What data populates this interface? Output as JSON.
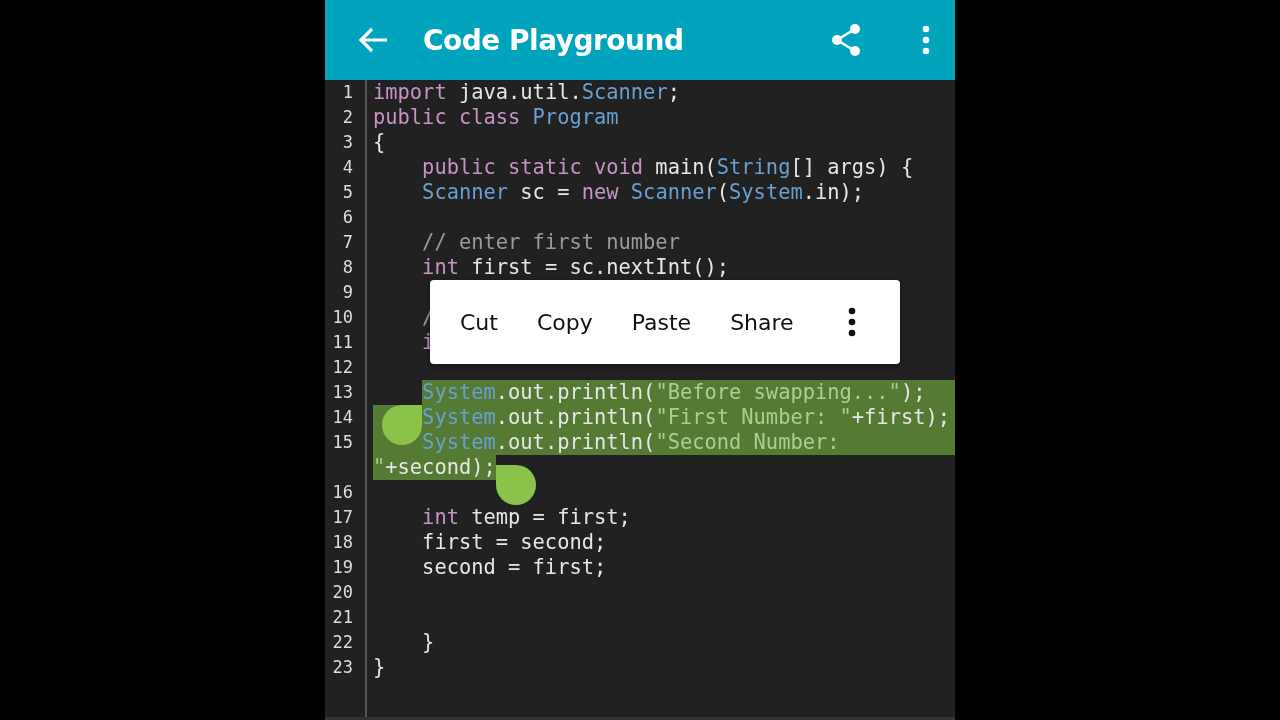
{
  "app_bar": {
    "title": "Code Playground"
  },
  "lines": [
    {
      "number": "1",
      "selected": false,
      "tokens": [
        {
          "text": "import",
          "kind": "kw"
        },
        {
          "text": " java.util.",
          "kind": "plain"
        },
        {
          "text": "Scanner",
          "kind": "type"
        },
        {
          "text": ";",
          "kind": "plain"
        }
      ]
    },
    {
      "number": "2",
      "selected": false,
      "tokens": [
        {
          "text": "public class ",
          "kind": "kw"
        },
        {
          "text": "Program",
          "kind": "type"
        }
      ]
    },
    {
      "number": "3",
      "selected": false,
      "tokens": [
        {
          "text": "{",
          "kind": "plain"
        }
      ]
    },
    {
      "number": "4",
      "selected": false,
      "tokens": [
        {
          "text": "    public static void",
          "kind": "kw"
        },
        {
          "text": " main(",
          "kind": "plain"
        },
        {
          "text": "String",
          "kind": "type"
        },
        {
          "text": "[] args) {",
          "kind": "plain"
        }
      ]
    },
    {
      "number": "5",
      "selected": false,
      "tokens": [
        {
          "text": "    Scanner",
          "kind": "type"
        },
        {
          "text": " sc = ",
          "kind": "plain"
        },
        {
          "text": "new ",
          "kind": "kw"
        },
        {
          "text": "Scanner",
          "kind": "type"
        },
        {
          "text": "(",
          "kind": "plain"
        },
        {
          "text": "System",
          "kind": "type"
        },
        {
          "text": ".in);",
          "kind": "plain"
        }
      ]
    },
    {
      "number": "6",
      "selected": false
    },
    {
      "number": "7",
      "selected": false,
      "tokens": [
        {
          "text": "    // enter first number",
          "kind": "comment"
        }
      ]
    },
    {
      "number": "8",
      "selected": false,
      "tokens": [
        {
          "text": "    int",
          "kind": "kw"
        },
        {
          "text": " first = sc.nextInt();",
          "kind": "plain"
        }
      ]
    },
    {
      "number": "9",
      "selected": false
    },
    {
      "number": "10",
      "selected": false,
      "tokens": [
        {
          "text": "    /",
          "kind": "comment"
        }
      ]
    },
    {
      "number": "11",
      "selected": false,
      "tokens": [
        {
          "text": "    i",
          "kind": "kw"
        }
      ]
    },
    {
      "number": "12",
      "selected": false
    },
    {
      "number": "13",
      "selected": true,
      "tokens": [
        {
          "text": "    System",
          "kind": "type"
        },
        {
          "text": ".out.println(",
          "kind": "plain"
        },
        {
          "text": "\"Before swapping...\"",
          "kind": "string"
        },
        {
          "text": ");",
          "kind": "plain"
        }
      ]
    },
    {
      "number": "14",
      "selected": true,
      "tokens": [
        {
          "text": "    System",
          "kind": "type"
        },
        {
          "text": ".out.println(",
          "kind": "plain"
        },
        {
          "text": "\"First Number: \"",
          "kind": "string"
        },
        {
          "text": "+first);",
          "kind": "plain"
        }
      ]
    },
    {
      "number": "15",
      "selected": true,
      "tokens": [
        {
          "text": "    System",
          "kind": "type"
        },
        {
          "text": ".out.println(",
          "kind": "plain"
        },
        {
          "text": "\"Second Number:",
          "kind": "string"
        }
      ],
      "wrapped": [
        {
          "text": "\"",
          "kind": "string"
        },
        {
          "text": "+second);",
          "kind": "plain"
        }
      ]
    },
    {
      "number": "16",
      "selected": false
    },
    {
      "number": "17",
      "selected": false,
      "tokens": [
        {
          "text": "    int",
          "kind": "kw"
        },
        {
          "text": " temp = first;",
          "kind": "plain"
        }
      ]
    },
    {
      "number": "18",
      "selected": false,
      "tokens": [
        {
          "text": "    first = second;",
          "kind": "plain"
        }
      ]
    },
    {
      "number": "19",
      "selected": false,
      "tokens": [
        {
          "text": "    second = first;",
          "kind": "plain"
        }
      ]
    },
    {
      "number": "20",
      "selected": false
    },
    {
      "number": "21",
      "selected": false
    },
    {
      "number": "22",
      "selected": false,
      "tokens": [
        {
          "text": "    }",
          "kind": "plain"
        }
      ]
    },
    {
      "number": "23",
      "selected": false,
      "tokens": [
        {
          "text": "}",
          "kind": "plain"
        }
      ]
    }
  ],
  "context_menu": {
    "items": [
      "Cut",
      "Copy",
      "Paste",
      "Share"
    ]
  }
}
